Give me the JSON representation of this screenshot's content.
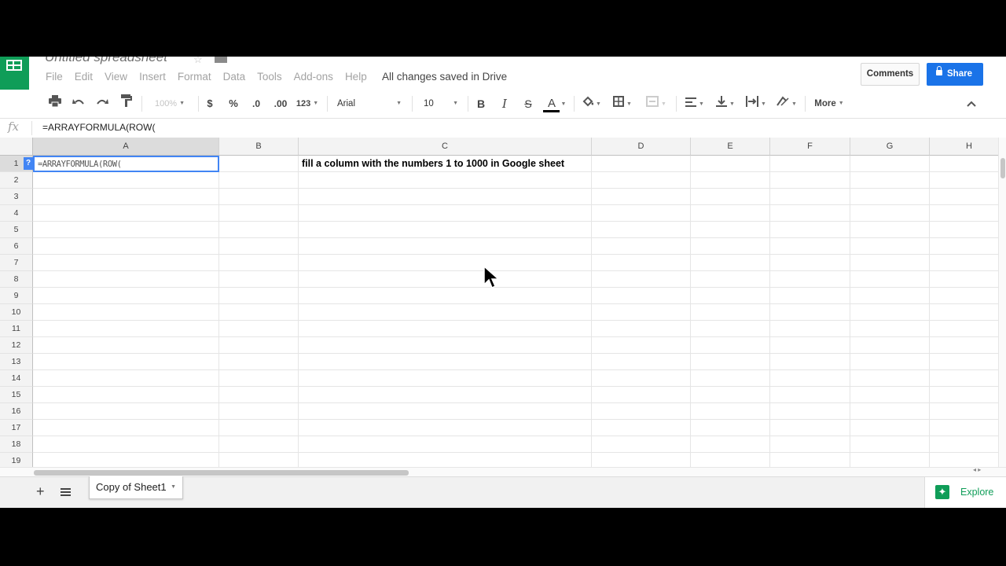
{
  "header": {
    "doc_title": "Untitled spreadsheet",
    "saved_status": "All changes saved in Drive",
    "comments_label": "Comments",
    "share_label": "Share"
  },
  "menu": [
    "File",
    "Edit",
    "View",
    "Insert",
    "Format",
    "Data",
    "Tools",
    "Add-ons",
    "Help"
  ],
  "toolbar": {
    "zoom": "100%",
    "currency": "$",
    "percent": "%",
    "decrease_decimals": ".0",
    "increase_decimals": ".00",
    "more_formats": "123",
    "font_family": "Arial",
    "font_size": "10",
    "bold": "B",
    "italic": "I",
    "strikethrough": "S",
    "text_color": "A",
    "more_label": "More"
  },
  "formula_bar": {
    "fx": "fx",
    "content": "=ARRAYFORMULA(ROW("
  },
  "grid": {
    "columns": [
      "A",
      "B",
      "C",
      "D",
      "E",
      "F",
      "G",
      "H"
    ],
    "rows": [
      "1",
      "2",
      "3",
      "4",
      "5",
      "6",
      "7",
      "8",
      "9",
      "10",
      "11",
      "12",
      "13",
      "14",
      "15",
      "16",
      "17",
      "18",
      "19"
    ],
    "active_cell_editing_text": "=ARRAYFORMULA(ROW(",
    "help_badge": "?",
    "cell_C1": "fill a column with the numbers 1 to 1000 in Google sheet"
  },
  "sheets": {
    "add_label": "+",
    "tabs": [
      "Copy of Sheet1"
    ],
    "explore_label": "Explore"
  },
  "colors": {
    "accent_green": "#0f9d58",
    "share_blue": "#1a73e8",
    "selection_blue": "#4285f4"
  }
}
